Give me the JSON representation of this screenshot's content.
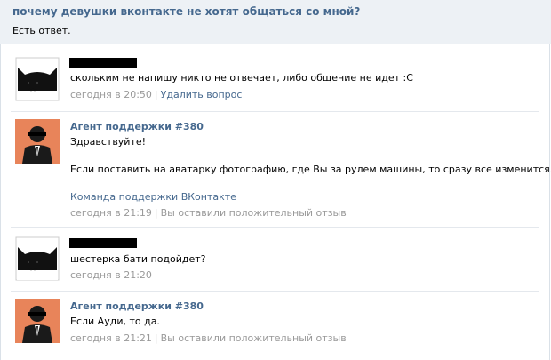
{
  "question": {
    "title": "почему девушки вконтакте не хотят общаться со мной?",
    "status": "Есть ответ."
  },
  "messages": [
    {
      "avatar": "cat-avatar",
      "text": "скольким не напишу никто не отвечает, либо общение не идет :С",
      "time": "сегодня в 20:50",
      "action": "Удалить вопрос"
    },
    {
      "avatar": "agent-avatar",
      "author": "Агент поддержки #380",
      "line1": "Здравствуйте!",
      "line2": "Если поставить на аватарку фотографию, где Вы за рулем машины, то сразу все изменится.",
      "signature": "Команда поддержки ВКонтакте",
      "time": "сегодня в 21:19",
      "rating": "Вы оставили положительный отзыв"
    },
    {
      "avatar": "cat-avatar",
      "text": "шестерка бати подойдет?",
      "time": "сегодня в 21:20"
    },
    {
      "avatar": "agent-avatar",
      "author": "Агент поддержки #380",
      "text": "Если Ауди, то да.",
      "time": "сегодня в 21:21",
      "rating": "Вы оставили положительный отзыв"
    }
  ],
  "colors": {
    "link": "#45688e",
    "header_bg": "#edf1f5",
    "meta": "#999999",
    "agent_bg": "#e8845a"
  }
}
